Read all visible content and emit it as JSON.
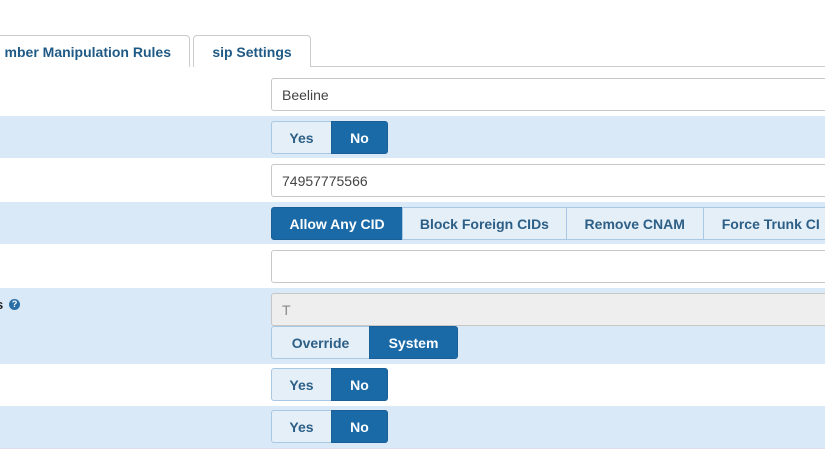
{
  "tabs": [
    {
      "label": "mber Manipulation Rules"
    },
    {
      "label": "sip Settings"
    }
  ],
  "fields": {
    "trunk_name": {
      "value": "Beeline"
    },
    "hide_callerid": {
      "options": [
        "Yes",
        "No"
      ],
      "selected": "No"
    },
    "outbound_callerid": {
      "value": "74957775566"
    },
    "cid_options": {
      "options": [
        "Allow Any CID",
        "Block Foreign CIDs",
        "Remove CNAM",
        "Force Trunk CI"
      ],
      "selected": "Allow Any CID"
    },
    "empty_field": {
      "value": ""
    },
    "asterisk_channels": {
      "label": "ns",
      "value": "T",
      "options": [
        "Override",
        "System"
      ],
      "selected": "System"
    },
    "toggle_a": {
      "options": [
        "Yes",
        "No"
      ],
      "selected": "No"
    },
    "toggle_b": {
      "options": [
        "Yes",
        "No"
      ],
      "selected": "No"
    }
  },
  "colors": {
    "row_shade": "#d9e9f7",
    "active_button": "#1a6aa8",
    "tab_text": "#1f5a86"
  }
}
